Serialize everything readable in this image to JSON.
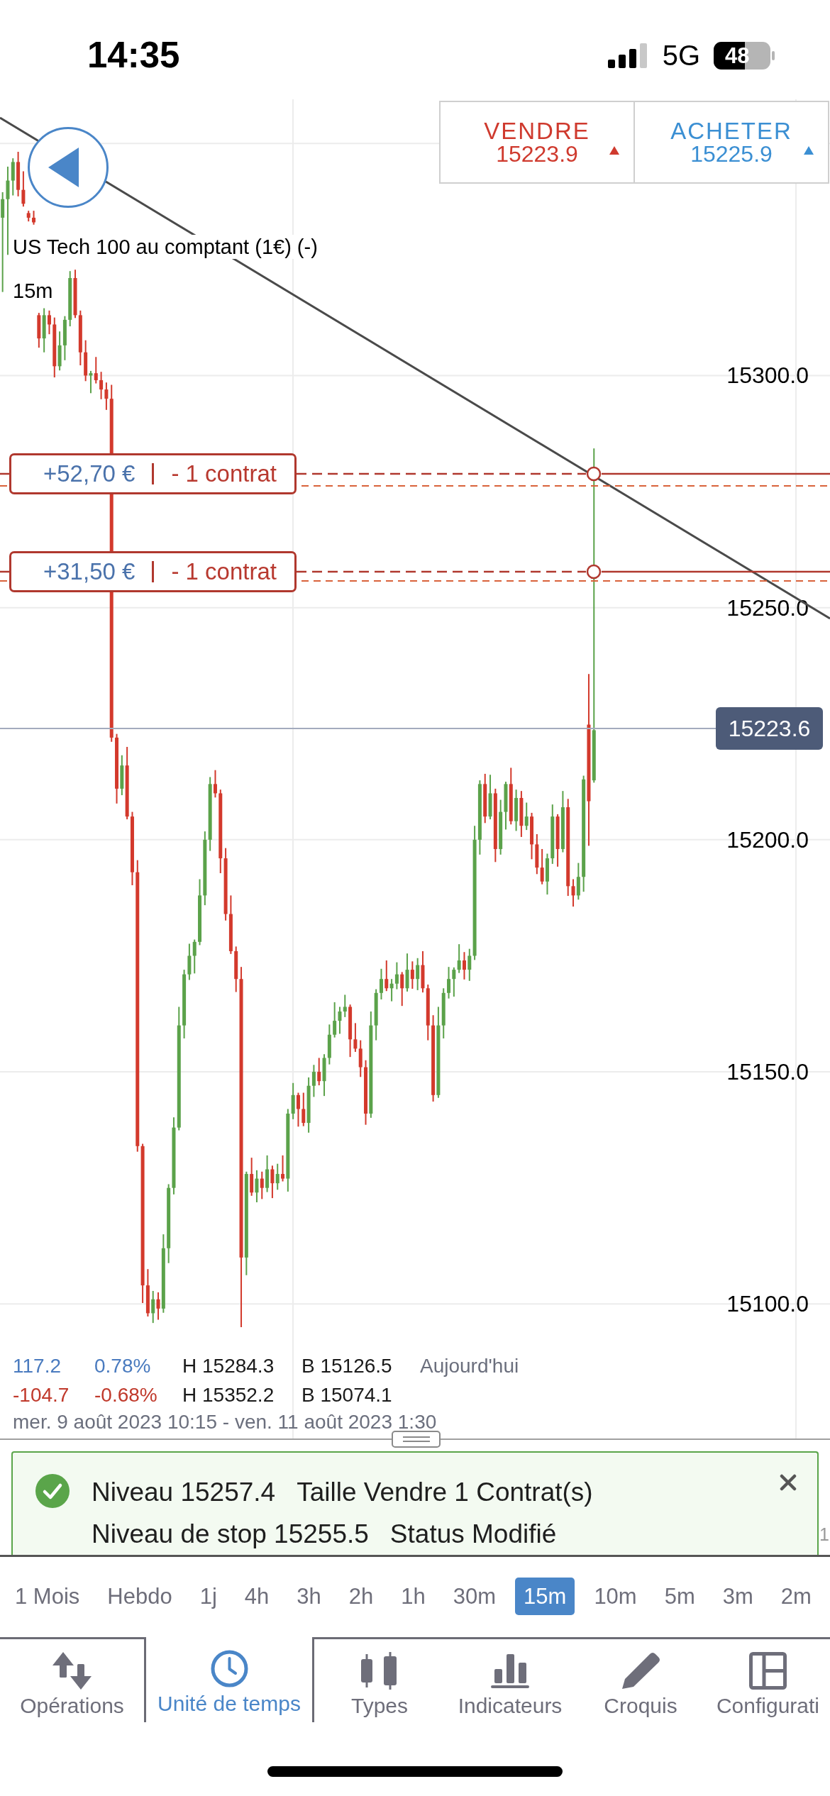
{
  "status_bar": {
    "time": "14:35",
    "network": "5G",
    "battery": "48"
  },
  "quote": {
    "sell": {
      "label": "VENDRE",
      "price": "15223.9",
      "rising": true
    },
    "buy": {
      "label": "ACHETER",
      "price": "15225.9",
      "rising": true
    }
  },
  "instrument": {
    "name": "US Tech 100 au comptant (1€) (-)",
    "interval": "15m"
  },
  "chart": {
    "chart_data": {
      "type": "candlestick",
      "grid": true,
      "ylim": [
        14994,
        15380.9
      ],
      "yticks": [
        {
          "value": 15300,
          "label": "15300.0"
        },
        {
          "value": 15250,
          "label": "15250.0"
        },
        {
          "value": 15200,
          "label": "15200.0"
        },
        {
          "value": 15150,
          "label": "15150.0"
        },
        {
          "value": 15100,
          "label": "15100.0"
        }
      ],
      "categories": [
        null,
        null,
        null,
        null,
        null,
        null,
        null,
        null,
        null,
        null,
        null,
        null,
        null,
        null,
        null,
        null,
        null,
        null,
        null,
        null,
        null,
        null,
        null,
        null,
        null,
        null,
        null,
        null,
        null,
        null,
        null,
        null,
        null,
        null,
        null,
        null,
        null,
        null,
        null,
        null,
        null,
        null,
        null,
        null,
        null,
        null,
        null,
        null,
        null,
        null,
        null,
        null,
        null,
        null,
        null,
        null,
        null,
        null,
        null,
        null,
        null,
        null,
        null,
        null,
        null,
        null,
        null,
        null,
        null,
        null,
        null,
        null,
        null,
        null,
        null,
        null,
        null,
        null,
        null,
        null,
        null,
        null,
        null,
        null,
        null,
        null,
        null,
        null,
        null,
        null,
        null,
        null,
        null,
        null,
        null,
        null,
        null,
        null,
        null,
        null,
        null,
        null,
        null,
        null,
        null,
        null,
        null,
        null,
        null,
        null,
        null,
        null,
        null,
        null,
        null,
        null,
        null,
        null,
        null,
        null,
        null,
        null,
        null,
        null,
        null,
        null,
        null,
        null,
        null,
        null,
        null,
        null,
        null,
        null,
        null,
        null,
        null,
        null,
        null,
        null,
        null,
        null,
        null,
        null,
        null,
        null,
        null,
        null,
        null,
        null,
        null,
        null,
        null,
        null,
        null,
        null,
        null,
        null,
        null,
        null
      ],
      "ohlc": [
        [
          15334,
          15339.5,
          15318,
          15338
        ],
        [
          15338,
          15345,
          15326,
          15342
        ],
        [
          15342,
          15346.8,
          15338.8,
          15346
        ],
        [
          15346,
          15348.2,
          15338.6,
          15340
        ],
        [
          15340,
          15344,
          15336.4,
          15337
        ],
        [
          15335,
          15335.5,
          15333.2,
          15334
        ],
        [
          15334,
          15335.5,
          15332.5,
          15333
        ],
        [
          15313,
          15313.5,
          15306,
          15308
        ],
        [
          15308,
          15314.5,
          15305,
          15313
        ],
        [
          15313,
          15314,
          15308.9,
          15311
        ],
        [
          15311,
          15312.5,
          15299.6,
          15302
        ],
        [
          15302,
          15309.5,
          15301.1,
          15306.5
        ],
        [
          15306.5,
          15312.8,
          15303.3,
          15312
        ],
        [
          15312,
          15322.5,
          15310.6,
          15321
        ],
        [
          15321,
          15322.8,
          15312.4,
          15313
        ],
        [
          15313,
          15314,
          15302.2,
          15305
        ],
        [
          15305,
          15307.6,
          15298.8,
          15300
        ],
        [
          15300,
          15301,
          15296.2,
          15300.5
        ],
        [
          15300.5,
          15304,
          15298.3,
          15299
        ],
        [
          15299,
          15300.8,
          15294.9,
          15297
        ],
        [
          15297,
          15298.5,
          15292.6,
          15295
        ],
        [
          15295,
          15298,
          15221.1,
          15222
        ],
        [
          15222,
          15222.8,
          15207.8,
          15211
        ],
        [
          15211,
          15218.2,
          15209.6,
          15216
        ],
        [
          15216,
          15220,
          15204.4,
          15205
        ],
        [
          15205,
          15206,
          15190.2,
          15193
        ],
        [
          15193,
          15195.6,
          15132.8,
          15134
        ],
        [
          15134,
          15134.5,
          15100.2,
          15104
        ],
        [
          15104,
          15107.5,
          15097.3,
          15098
        ],
        [
          15098,
          15102.8,
          15095.9,
          15101
        ],
        [
          15101,
          15102.5,
          15096.6,
          15099
        ],
        [
          15099,
          15115,
          15098.1,
          15112
        ],
        [
          15112,
          15125.8,
          15108.8,
          15125
        ],
        [
          15125,
          15140.2,
          15123.6,
          15138
        ],
        [
          15138,
          15164,
          15137.4,
          15160
        ],
        [
          15160,
          15172,
          15157.2,
          15171
        ],
        [
          15171,
          15177.6,
          15169.8,
          15175
        ],
        [
          15175,
          15178.5,
          15171.2,
          15178
        ],
        [
          15178,
          15191.5,
          15177.3,
          15188
        ],
        [
          15188,
          15201.8,
          15185.9,
          15200
        ],
        [
          15200,
          15213.5,
          15197.6,
          15212
        ],
        [
          15212,
          15215,
          15209.1,
          15210
        ],
        [
          15210,
          15210.8,
          15192.8,
          15196
        ],
        [
          15196,
          15198.2,
          15182.6,
          15184
        ],
        [
          15184,
          15188,
          15175.4,
          15176
        ],
        [
          15176,
          15177,
          15167.2,
          15170
        ],
        [
          15170,
          15172.6,
          15095,
          15110
        ],
        [
          15110,
          15128.5,
          15106.2,
          15128
        ],
        [
          15128,
          15131.5,
          15123.3,
          15124
        ],
        [
          15124,
          15128.8,
          15121.9,
          15127
        ],
        [
          15127,
          15128.5,
          15122.6,
          15125
        ],
        [
          15125,
          15132,
          15124.1,
          15129
        ],
        [
          15129,
          15129.8,
          15122.8,
          15126
        ],
        [
          15126,
          15130.2,
          15124.6,
          15128
        ],
        [
          15128,
          15132,
          15126.4,
          15127
        ],
        [
          15127,
          15142,
          15124.2,
          15141
        ],
        [
          15141,
          15147.6,
          15139.8,
          15145
        ],
        [
          15145,
          15145.5,
          15138.2,
          15142
        ],
        [
          15142,
          15145.5,
          15138.3,
          15139
        ],
        [
          15139,
          15148.8,
          15136.9,
          15147
        ],
        [
          15147,
          15151.5,
          15144.6,
          15150
        ],
        [
          15150,
          15153,
          15147.1,
          15148
        ],
        [
          15148,
          15153.8,
          15144.8,
          15153
        ],
        [
          15153,
          15160.2,
          15151.6,
          15158
        ],
        [
          15158,
          15165,
          15157.4,
          15161
        ],
        [
          15161,
          15164,
          15158.2,
          15163
        ],
        [
          15163,
          15166.6,
          15161.8,
          15164
        ],
        [
          15164,
          15164.5,
          15153.2,
          15157
        ],
        [
          15157,
          15160.5,
          15154.3,
          15155
        ],
        [
          15155,
          15156.8,
          15148.9,
          15151
        ],
        [
          15151,
          15152.5,
          15138.6,
          15141
        ],
        [
          15141,
          15163,
          15140.1,
          15160
        ],
        [
          15160,
          15167.8,
          15156.8,
          15167
        ],
        [
          15167,
          15172.2,
          15165.6,
          15170
        ],
        [
          15170,
          15174,
          15167.4,
          15168
        ],
        [
          15168,
          15170,
          15165.2,
          15169
        ],
        [
          15169,
          15173.6,
          15167.8,
          15171
        ],
        [
          15171,
          15171.5,
          15164.2,
          15168
        ],
        [
          15168,
          15175.5,
          15167.3,
          15172
        ],
        [
          15172,
          15173.8,
          15167.9,
          15170
        ],
        [
          15170,
          15174.5,
          15167.6,
          15173
        ],
        [
          15173,
          15176,
          15167.1,
          15168
        ],
        [
          15168,
          15168.8,
          15156.8,
          15160
        ],
        [
          15160,
          15162.2,
          15143.6,
          15145
        ],
        [
          15145,
          15164,
          15144.4,
          15160
        ],
        [
          15160,
          15168,
          15157.2,
          15167
        ],
        [
          15167,
          15172.6,
          15165.8,
          15170
        ],
        [
          15170,
          15172.5,
          15166.2,
          15172
        ],
        [
          15172,
          15177.5,
          15171.3,
          15174
        ],
        [
          15174,
          15175.8,
          15169.9,
          15172
        ],
        [
          15172,
          15176.5,
          15169.6,
          15175
        ],
        [
          15175,
          15203,
          15174.1,
          15200
        ],
        [
          15200,
          15212.8,
          15196.8,
          15212
        ],
        [
          15212,
          15214.2,
          15203.6,
          15205
        ],
        [
          15205,
          15214,
          15204.4,
          15210
        ],
        [
          15210,
          15211,
          15195.2,
          15198
        ],
        [
          15198,
          15208.6,
          15196.8,
          15206
        ],
        [
          15206,
          15212.5,
          15202.2,
          15212
        ],
        [
          15212,
          15215.5,
          15203.3,
          15204
        ],
        [
          15204,
          15210.8,
          15201.9,
          15209
        ],
        [
          15209,
          15210.5,
          15200.6,
          15203
        ],
        [
          15203,
          15208,
          15202.1,
          15205
        ],
        [
          15205,
          15205.8,
          15195.8,
          15199
        ],
        [
          15199,
          15201.2,
          15192.6,
          15194
        ],
        [
          15194,
          15198,
          15190.4,
          15191
        ],
        [
          15191,
          15197,
          15188.2,
          15196
        ],
        [
          15196,
          15207.6,
          15194.8,
          15205
        ],
        [
          15205,
          15205.5,
          15194.2,
          15198
        ],
        [
          15198,
          15210.5,
          15197.3,
          15207
        ],
        [
          15207,
          15208.8,
          15187.9,
          15190
        ],
        [
          15190,
          15191.5,
          15185.6,
          15188
        ],
        [
          15188,
          15195,
          15187.1,
          15192
        ],
        [
          15192,
          15213.8,
          15188.8,
          15213
        ],
        [
          15224.8,
          15235.7,
          15198.7,
          15208.3
        ],
        [
          15212.8,
          15284.3,
          15212.3,
          15223.6
        ],
        null,
        null,
        null,
        null,
        null,
        null,
        null,
        null,
        null,
        null,
        null,
        null,
        null,
        null,
        null,
        null,
        null,
        null,
        null,
        null,
        null,
        null,
        null,
        null,
        null,
        null,
        null,
        null,
        null,
        null,
        null,
        null,
        null,
        null,
        null,
        null,
        null,
        null,
        null,
        null,
        null,
        null,
        null,
        null,
        null
      ]
    }
  },
  "current_price": "15223.6",
  "orders": [
    {
      "pnl": "+52,70 €",
      "size": "- 1 contrat"
    },
    {
      "pnl": "+31,50 €",
      "size": "- 1 contrat"
    }
  ],
  "stats": [
    {
      "negative": false,
      "change": "117.2",
      "percent": "0.78%",
      "high": "H 15284.3",
      "low": "B 15126.5",
      "period": "Aujourd'hui"
    },
    {
      "negative": true,
      "change": "-104.7",
      "percent": "-0.68%",
      "high": "H 15352.2",
      "low": "B 15074.1"
    }
  ],
  "date_range": "mer. 9 août 2023 10:15 - ven. 11 août 2023 1:30",
  "axis_fragment": "1",
  "notification": {
    "success": true,
    "lines": [
      [
        "Niveau 15257.4",
        "Taille Vendre 1 Contrat(s)"
      ],
      [
        "Niveau de stop 15255.5",
        "Status Modifié"
      ]
    ]
  },
  "timeframes": [
    {
      "label": "1 Mois",
      "selected": false
    },
    {
      "label": "Hebdo",
      "selected": false
    },
    {
      "label": "1j",
      "selected": false
    },
    {
      "label": "4h",
      "selected": false
    },
    {
      "label": "3h",
      "selected": false
    },
    {
      "label": "2h",
      "selected": false
    },
    {
      "label": "1h",
      "selected": false
    },
    {
      "label": "30m",
      "selected": false
    },
    {
      "label": "15m",
      "selected": true
    },
    {
      "label": "10m",
      "selected": false
    },
    {
      "label": "5m",
      "selected": false
    },
    {
      "label": "3m",
      "selected": false
    },
    {
      "label": "2m",
      "selected": false
    }
  ],
  "toolbar": [
    {
      "label": "Opérations",
      "selected": false
    },
    {
      "label": "Unité de temps",
      "selected": true
    },
    {
      "label": "Types",
      "selected": false
    },
    {
      "label": "Indicateurs",
      "selected": false
    },
    {
      "label": "Croquis",
      "selected": false
    },
    {
      "label": "Configurati",
      "selected": false
    }
  ]
}
